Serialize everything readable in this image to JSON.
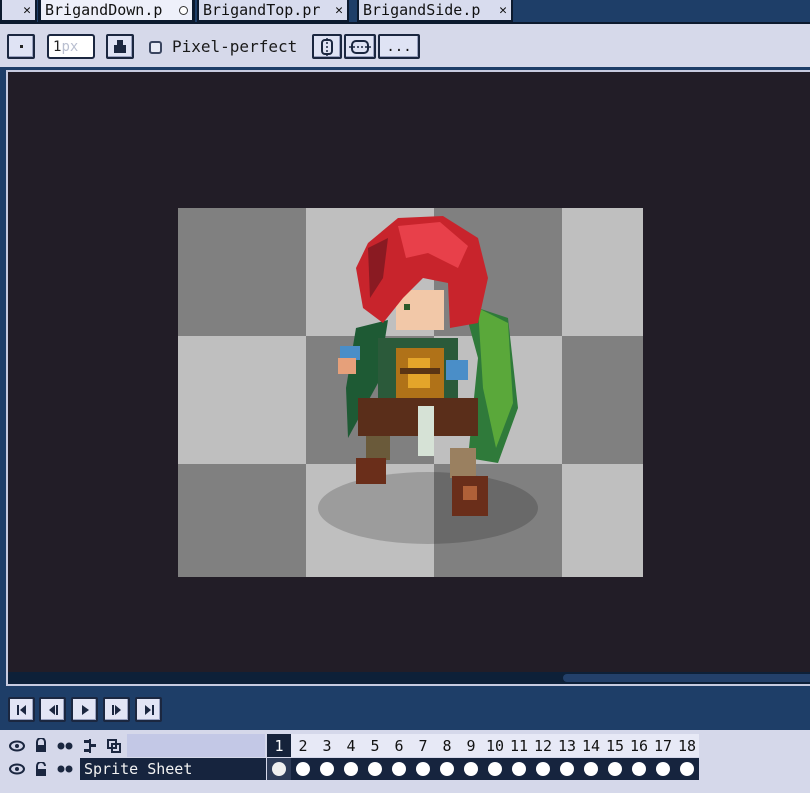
{
  "tabs": [
    {
      "label": "",
      "close": "✕",
      "active": false
    },
    {
      "label": "BrigandDown.p",
      "close": "",
      "active": true,
      "modified": true
    },
    {
      "label": "BrigandTop.pr",
      "close": "✕",
      "active": false
    },
    {
      "label": "BrigandSide.p",
      "close": "✕",
      "active": false
    }
  ],
  "toolbar": {
    "zoom_value": "1",
    "zoom_placeholder": "px",
    "pixel_perfect_label": "Pixel-perfect",
    "more_label": "...",
    "icons": [
      "dot-icon",
      "ink-icon",
      "symmetry-vertical-icon",
      "symmetry-horizontal-icon"
    ]
  },
  "playback": {
    "buttons": [
      "first-frame-icon",
      "previous-frame-icon",
      "play-icon",
      "next-frame-icon",
      "last-frame-icon"
    ]
  },
  "timeline": {
    "header_icons": [
      "eye-icon",
      "lock-icon",
      "onion-skin-icon",
      "continuous-icon",
      "cel-link-icon"
    ],
    "frames": [
      "1",
      "2",
      "3",
      "4",
      "5",
      "6",
      "7",
      "8",
      "9",
      "10",
      "11",
      "12",
      "13",
      "14",
      "15",
      "16",
      "17",
      "18"
    ],
    "selected_frame": "1",
    "layers": [
      {
        "name": "Sprite Sheet",
        "visible": true,
        "locked": false
      }
    ]
  },
  "colors": {
    "window_bg": "#1e3e68",
    "canvas_bg": "#221d27",
    "checker_dark": "#808080",
    "checker_light": "#bfbfbf",
    "panel_bg": "#d6d9ea",
    "selected": "#15223a"
  }
}
